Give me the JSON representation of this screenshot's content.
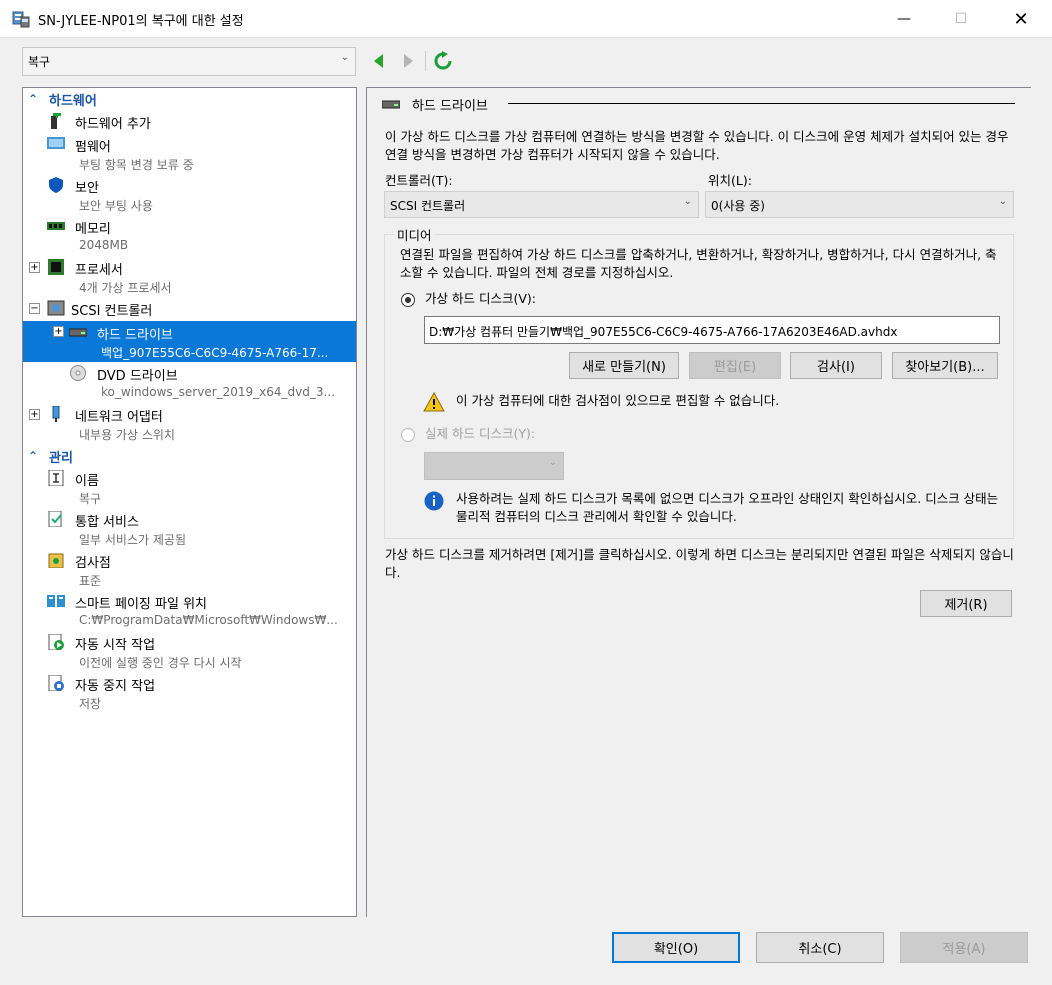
{
  "window": {
    "title": "SN-JYLEE-NP01의 복구에 대한 설정",
    "minimize": "—",
    "maximize": "☐",
    "close": "✕"
  },
  "nav": {
    "selected": "복구",
    "back_icon": "back-arrow-icon",
    "forward_icon": "forward-arrow-icon",
    "refresh_icon": "refresh-icon"
  },
  "tree": {
    "hardware_label": "하드웨어",
    "management_label": "관리",
    "items": [
      {
        "title": "하드웨어 추가",
        "sub": ""
      },
      {
        "title": "펌웨어",
        "sub": "부팅 항목 변경 보류 중"
      },
      {
        "title": "보안",
        "sub": "보안 부팅 사용"
      },
      {
        "title": "메모리",
        "sub": "2048MB"
      },
      {
        "title": "프로세서",
        "sub": "4개 가상 프로세서"
      },
      {
        "title": "SCSI 컨트롤러",
        "sub": ""
      },
      {
        "title": "하드 드라이브",
        "sub": "백업_907E55C6-C6C9-4675-A766-17..."
      },
      {
        "title": "DVD 드라이브",
        "sub": "ko_windows_server_2019_x64_dvd_3..."
      },
      {
        "title": "네트워크 어댑터",
        "sub": "내부용 가상 스위치"
      }
    ],
    "mgmt_items": [
      {
        "title": "이름",
        "sub": "복구"
      },
      {
        "title": "통합 서비스",
        "sub": "일부 서비스가 제공됨"
      },
      {
        "title": "검사점",
        "sub": "표준"
      },
      {
        "title": "스마트 페이징 파일 위치",
        "sub": "C:₩ProgramData₩Microsoft₩Windows₩..."
      },
      {
        "title": "자동 시작 작업",
        "sub": "이전에 실행 중인 경우 다시 시작"
      },
      {
        "title": "자동 중지 작업",
        "sub": "저장"
      }
    ]
  },
  "panel": {
    "section_title": "하드 드라이브",
    "intro": "이 가상 하드 디스크를 가상 컴퓨터에 연결하는 방식을 변경할 수 있습니다. 이 디스크에 운영 체제가 설치되어 있는 경우 연결 방식을 변경하면 가상 컴퓨터가 시작되지 않을 수 있습니다.",
    "controller_label": "컨트롤러(T):",
    "controller_value": "SCSI 컨트롤러",
    "location_label": "위치(L):",
    "location_value": "0(사용 중)",
    "media_label": "미디어",
    "media_desc": "연결된 파일을 편집하여 가상 하드 디스크를 압축하거나, 변환하거나, 확장하거나, 병합하거나, 다시 연결하거나, 축소할 수 있습니다. 파일의 전체 경로를 지정하십시오.",
    "vhd_radio": "가상 하드 디스크(V):",
    "vhd_path": "D:₩가상 컴퓨터 만들기₩백업_907E55C6-C6C9-4675-A766-17A6203E46AD.avhdx",
    "btn_new": "새로 만들기(N)",
    "btn_edit": "편집(E)",
    "btn_inspect": "검사(I)",
    "btn_browse": "찾아보기(B)...",
    "warning": "이 가상 컴퓨터에 대한 검사점이 있으므로 편집할 수 없습니다.",
    "physical_radio": "실제 하드 디스크(Y):",
    "info": "사용하려는 실제 하드 디스크가 목록에 없으면 디스크가 오프라인 상태인지 확인하십시오. 디스크 상태는 물리적 컴퓨터의 디스크 관리에서 확인할 수 있습니다.",
    "remove_desc": "가상 하드 디스크를 제거하려면 [제거]를 클릭하십시오. 이렇게 하면 디스크는 분리되지만 연결된 파일은 삭제되지 않습니다.",
    "btn_remove": "제거(R)"
  },
  "footer": {
    "ok": "확인(O)",
    "cancel": "취소(C)",
    "apply": "적용(A)"
  }
}
